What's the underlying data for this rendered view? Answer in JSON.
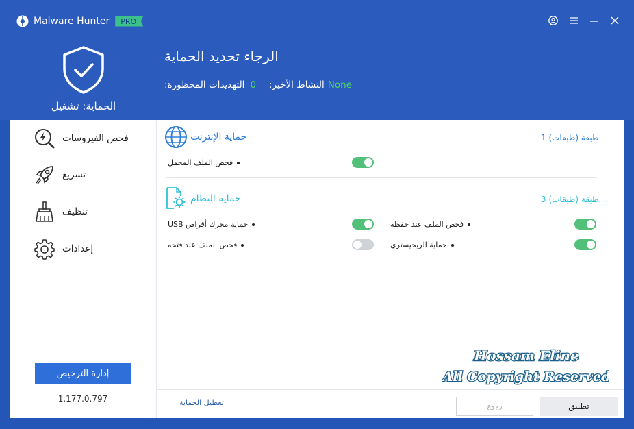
{
  "app": {
    "name": "Malware Hunter",
    "edition": "PRO"
  },
  "header": {
    "protection_status": "الحماية: تشغيل",
    "headline": "الرجاء تحديد الحماية",
    "threats_label": ":التهديدات المحظورة",
    "threats_value": "0",
    "activity_label": ":النشاط الأخير",
    "activity_value": "None"
  },
  "sidebar": {
    "items": [
      {
        "label": "فحص الفيروسات",
        "icon": "scan-icon"
      },
      {
        "label": "تسريع",
        "icon": "rocket-icon"
      },
      {
        "label": "تنظيف",
        "icon": "broom-icon"
      },
      {
        "label": "إعدادات",
        "icon": "gear-icon"
      }
    ],
    "license_button": "إدارة الترخيص",
    "version": "1.177.0.797"
  },
  "sections": {
    "internet": {
      "title": "حماية الإنترنت",
      "layers": "طبقة (طبقات) 1",
      "items": [
        {
          "label": "فحص الملف المحمل",
          "enabled": true
        }
      ]
    },
    "system": {
      "title": "حماية النظام",
      "layers": "طبقة (طبقات) 3",
      "items": [
        {
          "label": "فحص الملف عند حفظه",
          "enabled": true
        },
        {
          "label": "حماية محرك أقراص USB",
          "enabled": true
        },
        {
          "label": "حماية الريجيستري",
          "enabled": true
        },
        {
          "label": "فحص الملف عند فتحه",
          "enabled": false
        }
      ]
    }
  },
  "footer": {
    "disable_link": "تعطيل الحماية",
    "back_button": "رجوع",
    "apply_button": "تطبيق"
  },
  "watermark": {
    "line1": "Hossam Eline",
    "line2": "All Copyright Reserved"
  },
  "colors": {
    "header_bg": "#2a5bbd",
    "accent": "#2f7fd9",
    "green": "#4cd964",
    "toggle_on": "#52c078"
  }
}
